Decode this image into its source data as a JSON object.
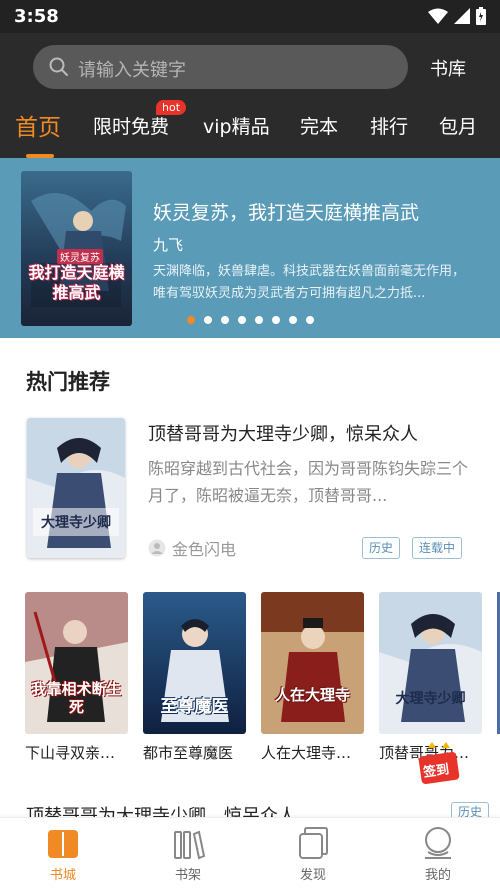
{
  "status": {
    "time": "3:58"
  },
  "header": {
    "search_placeholder": "请输入关键字",
    "library_label": "书库",
    "tabs": [
      {
        "label": "首页",
        "active": true
      },
      {
        "label": "限时免费",
        "badge": "hot"
      },
      {
        "label": "vip精品"
      },
      {
        "label": "完本"
      },
      {
        "label": "排行"
      },
      {
        "label": "包月"
      }
    ]
  },
  "banner": {
    "cover_text": "我打造天庭横推高武",
    "cover_small": "妖灵复苏",
    "title": "妖灵复苏，我打造天庭横推高武",
    "author": "九飞",
    "description": "天渊降临，妖兽肆虐。科技武器在妖兽面前毫无作用，唯有驾驭妖灵成为灵武者方可拥有超凡之力抵...",
    "dots": 8,
    "active_dot": 0
  },
  "hot": {
    "section_title": "热门推荐",
    "featured": {
      "title": "顶替哥哥为大理寺少卿，惊呆众人",
      "description": "陈昭穿越到古代社会，因为哥哥陈钧失踪三个月了，陈昭被逼无奈，顶替哥哥...",
      "author": "金色闪电",
      "tags": [
        "历史",
        "连载中"
      ],
      "cover_text": "大理寺少卿"
    },
    "books": [
      {
        "name": "下山寻双亲…",
        "cover_text": "我靠相术断生死",
        "color": "#7a2a2a"
      },
      {
        "name": "都市至尊魔医",
        "cover_text": "至尊魔医",
        "color": "#1f3f6a"
      },
      {
        "name": "人在大理寺…",
        "cover_text": "人在大理寺",
        "color": "#6a2a1a"
      },
      {
        "name": "顶替哥哥为…",
        "cover_text": "大理寺少卿",
        "color": "#2c3a55"
      }
    ],
    "checkin_label": "签到"
  },
  "next_item": {
    "title": "顶替哥哥为大理寺少卿，惊呆众人",
    "tag": "历史"
  },
  "bottom_nav": [
    {
      "label": "书城",
      "icon": "book-city-icon",
      "active": true
    },
    {
      "label": "书架",
      "icon": "bookshelf-icon"
    },
    {
      "label": "发现",
      "icon": "discover-icon"
    },
    {
      "label": "我的",
      "icon": "profile-icon"
    }
  ],
  "colors": {
    "accent": "#f08a24",
    "header_bg": "#2b2b2b",
    "banner_bg": "#5a9bb8"
  }
}
